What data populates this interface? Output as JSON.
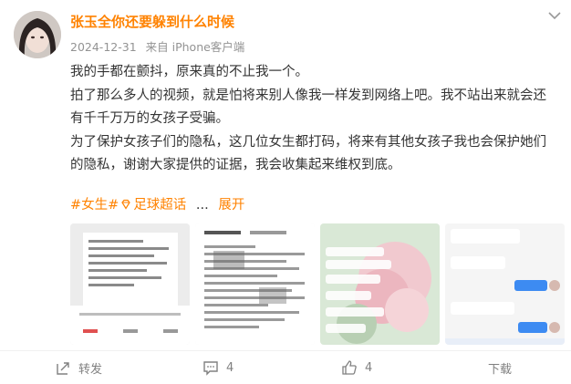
{
  "post": {
    "author": "张玉全你还要躲到什么时候",
    "date": "2024-12-31",
    "source": "来自 iPhone客户端",
    "lines": [
      "我的手都在颤抖，原来真的不止我一个。",
      "拍了那么多人的视频，就是怕将来别人像我一样发到网络上吧。我不站出来就会还",
      "有千千万万的女孩子受骗。",
      "为了保护女孩子们的隐私，这几位女生都打码，将来有其他女孩子我也会保护她们",
      "的隐私，谢谢大家提供的证据，我会收集起来维权到底。"
    ],
    "tag1": "#女生#",
    "tag2": "足球超话",
    "separator": "...",
    "expand": "展开"
  },
  "actions": {
    "repost": "转发",
    "comments": "4",
    "likes": "4",
    "download": "下载"
  },
  "icons": {
    "menu": "chevron-down-icon",
    "repost": "repost-icon",
    "comment": "comment-icon",
    "like": "like-icon",
    "tag": "diamond-icon"
  },
  "colors": {
    "accent": "#ff8200",
    "text": "#333333",
    "meta": "#939393",
    "action": "#808080"
  }
}
